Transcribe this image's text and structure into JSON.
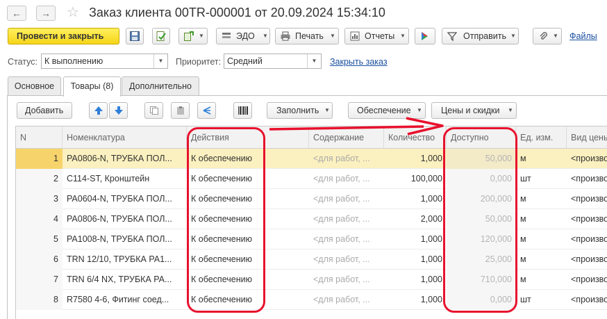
{
  "window": {
    "title": "Заказ клиента 00TR-000001 от 20.09.2024 15:34:10",
    "back_glyph": "←",
    "forward_glyph": "→",
    "star_glyph": "☆"
  },
  "toolbar": {
    "post_and_close": "Провести и закрыть",
    "edo": "ЭДО",
    "print": "Печать",
    "reports": "Отчеты",
    "send": "Отправить",
    "files": "Файлы",
    "icons": [
      "save-icon",
      "post-icon",
      "create-based-on-icon",
      "edo-icon",
      "print-icon",
      "reports-icon",
      "share-icon",
      "send-icon",
      "attachment-icon"
    ]
  },
  "status": {
    "status_label": "Статус:",
    "status_value": "К выполнению",
    "priority_label": "Приоритет:",
    "priority_value": "Средний",
    "close_order": "Закрыть заказ"
  },
  "tabs": [
    {
      "label": "Основное",
      "active": false
    },
    {
      "label": "Товары (8)",
      "active": true
    },
    {
      "label": "Дополнительно",
      "active": false
    }
  ],
  "table_toolbar": {
    "add": "Добавить",
    "fill": "Заполнить",
    "supply": "Обеспечение",
    "prices": "Цены и скидки"
  },
  "table": {
    "columns": [
      "N",
      "Номенклатура",
      "Действия",
      "Содержание",
      "Количество",
      "Доступно",
      "Ед. изм.",
      "Вид цены"
    ],
    "rows": [
      {
        "n": "1",
        "item": "PA0806-N, ТРУБКА ПОЛ...",
        "action": "К обеспечению",
        "content": "<для работ, ...",
        "qty": "1,000",
        "avail": "50,000",
        "unit": "м",
        "price_type": "<произво"
      },
      {
        "n": "2",
        "item": "C114-ST, Кронштейн",
        "action": "К обеспечению",
        "content": "<для работ, ...",
        "qty": "100,000",
        "avail": "0,000",
        "unit": "шт",
        "price_type": "<произво"
      },
      {
        "n": "3",
        "item": "PA0604-N, ТРУБКА ПОЛ...",
        "action": "К обеспечению",
        "content": "<для работ, ...",
        "qty": "1,000",
        "avail": "200,000",
        "unit": "м",
        "price_type": "<произво"
      },
      {
        "n": "4",
        "item": "PA0806-N, ТРУБКА ПОЛ...",
        "action": "К обеспечению",
        "content": "<для работ, ...",
        "qty": "2,000",
        "avail": "50,000",
        "unit": "м",
        "price_type": "<произво"
      },
      {
        "n": "5",
        "item": "PA1008-N, ТРУБКА ПОЛ...",
        "action": "К обеспечению",
        "content": "<для работ, ...",
        "qty": "1,000",
        "avail": "120,000",
        "unit": "м",
        "price_type": "<произво"
      },
      {
        "n": "6",
        "item": "TRN 12/10, ТРУБКА PA1...",
        "action": "К обеспечению",
        "content": "<для работ, ...",
        "qty": "1,000",
        "avail": "25,000",
        "unit": "м",
        "price_type": "<произво"
      },
      {
        "n": "7",
        "item": "TRN 6/4 NX, ТРУБКА PA...",
        "action": "К обеспечению",
        "content": "<для работ, ...",
        "qty": "1,000",
        "avail": "710,000",
        "unit": "м",
        "price_type": "<произво"
      },
      {
        "n": "8",
        "item": "R7580 4-6, Фитинг соед...",
        "action": "К обеспечению",
        "content": "<для работ, ...",
        "qty": "1,000",
        "avail": "0,000",
        "unit": "шт",
        "price_type": "<произво"
      }
    ]
  },
  "colors": {
    "primary_button": "#f6d51a",
    "selected_row": "#fbf0bf",
    "annotation_red": "#e8112d",
    "link": "#1a4fa0"
  }
}
